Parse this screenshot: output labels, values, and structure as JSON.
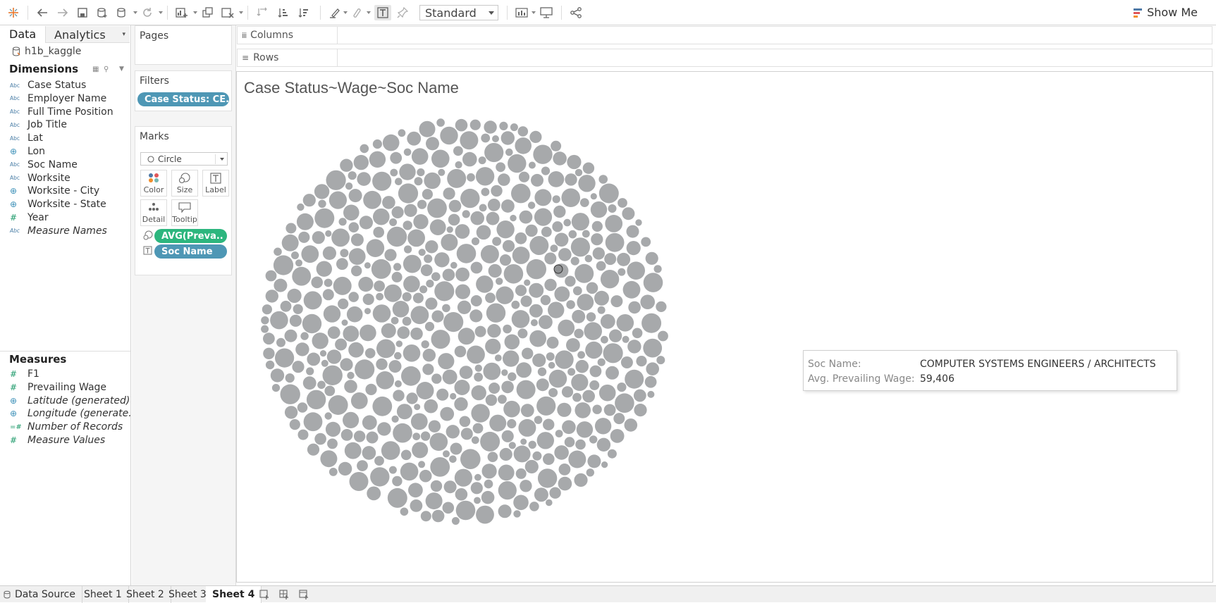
{
  "toolbar": {
    "fit_value": "Standard",
    "show_me_label": "Show Me",
    "icons": [
      "tableau-logo-icon",
      "undo-icon",
      "redo-icon",
      "save-icon",
      "new-datasource-icon",
      "datasource-icon",
      "refresh-icon",
      "new-worksheet-icon",
      "duplicate-icon",
      "clear-sheet-icon",
      "swap-icon",
      "sort-asc-icon",
      "sort-desc-icon",
      "highlight-icon",
      "group-icon",
      "show-labels-icon",
      "fix-axes-icon",
      "chart-icon",
      "presentation-icon",
      "share-icon"
    ]
  },
  "data_pane": {
    "tab_data": "Data",
    "tab_analytics": "Analytics",
    "datasource": "h1b_kaggle",
    "dimensions_header": "Dimensions",
    "dimensions": [
      {
        "label": "Case Status",
        "type": "Abc",
        "italic": false
      },
      {
        "label": "Employer Name",
        "type": "Abc",
        "italic": false
      },
      {
        "label": "Full Time Position",
        "type": "Abc",
        "italic": false
      },
      {
        "label": "Job Title",
        "type": "Abc",
        "italic": false
      },
      {
        "label": "Lat",
        "type": "Abc",
        "italic": false
      },
      {
        "label": "Lon",
        "type": "geo",
        "italic": false
      },
      {
        "label": "Soc Name",
        "type": "Abc",
        "italic": false
      },
      {
        "label": "Worksite",
        "type": "Abc",
        "italic": false
      },
      {
        "label": "Worksite - City",
        "type": "geo",
        "italic": false
      },
      {
        "label": "Worksite - State",
        "type": "geo",
        "italic": false
      },
      {
        "label": "Year",
        "type": "#",
        "italic": false
      },
      {
        "label": "Measure Names",
        "type": "Abc",
        "italic": true
      }
    ],
    "measures_header": "Measures",
    "measures": [
      {
        "label": "F1",
        "type": "#",
        "italic": false
      },
      {
        "label": "Prevailing Wage",
        "type": "#",
        "italic": false
      },
      {
        "label": "Latitude (generated)",
        "type": "geo",
        "italic": true
      },
      {
        "label": "Longitude (generate...",
        "type": "geo",
        "italic": true
      },
      {
        "label": "Number of Records",
        "type": "=#",
        "italic": true
      },
      {
        "label": "Measure Values",
        "type": "#",
        "italic": true
      }
    ]
  },
  "cards": {
    "pages_title": "Pages",
    "filters_title": "Filters",
    "filter_pill": "Case Status: CE..",
    "marks_title": "Marks",
    "mark_type": "Circle",
    "mark_buttons": {
      "color": "Color",
      "size": "Size",
      "label": "Label",
      "detail": "Detail",
      "tooltip": "Tooltip"
    },
    "size_pill": "AVG(Preva..",
    "label_pill": "Soc Name"
  },
  "shelves": {
    "columns": "Columns",
    "rows": "Rows"
  },
  "viz": {
    "title": "Case Status~Wage~Soc Name",
    "bubble_color": "#a7a9ab",
    "highlight_color": "#8f9193",
    "tooltip": {
      "soc_key": "Soc Name:",
      "soc_value": "COMPUTER SYSTEMS ENGINEERS / ARCHITECTS",
      "wage_key": "Avg. Prevailing Wage:",
      "wage_value": "59,406"
    }
  },
  "sheet_tabs": {
    "datasource": "Data Source",
    "sheets": [
      "Sheet 1",
      "Sheet 2",
      "Sheet 3",
      "Sheet 4"
    ],
    "active": "Sheet 4"
  }
}
